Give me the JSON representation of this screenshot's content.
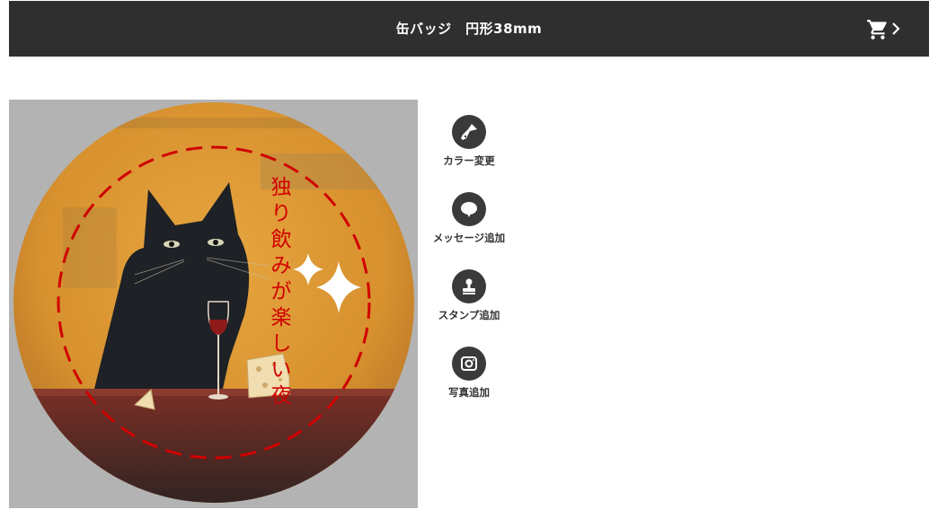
{
  "header": {
    "title": "缶バッジ　円形38mm"
  },
  "badge": {
    "text_lines": [
      "独",
      "り",
      "飲",
      "み",
      "が",
      "楽",
      "し",
      "い",
      "夜"
    ]
  },
  "tools": [
    {
      "label": "カラー変更",
      "icon": "paint-brush-icon"
    },
    {
      "label": "メッセージ追加",
      "icon": "speech-bubble-icon"
    },
    {
      "label": "スタンプ追加",
      "icon": "stamp-icon"
    },
    {
      "label": "写真追加",
      "icon": "camera-icon"
    }
  ],
  "colors": {
    "header_bg": "#2f2f2f",
    "canvas_bg": "#b3b3b3",
    "accent_red": "#d10000",
    "tool_circle": "#3a3a3a"
  }
}
